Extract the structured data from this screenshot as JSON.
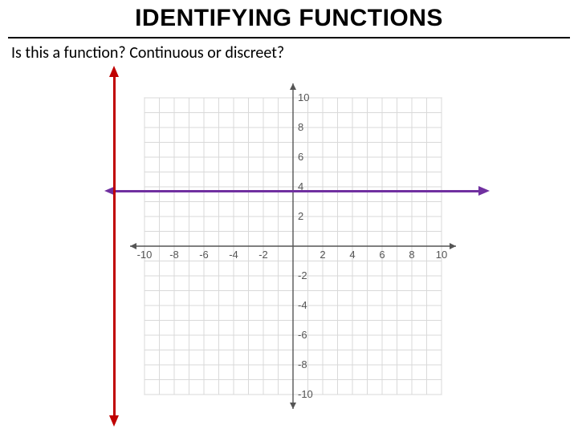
{
  "title": "IDENTIFYING FUNCTIONS",
  "subtitle": "Is this a function? Continuous or discreet?",
  "chart_data": {
    "type": "line",
    "title": "",
    "xlabel": "",
    "ylabel": "",
    "xlim": [
      -10,
      10
    ],
    "ylim": [
      -10,
      10
    ],
    "x_ticks": [
      -10,
      -8,
      -6,
      -4,
      -2,
      2,
      4,
      6,
      8,
      10
    ],
    "y_ticks": [
      -10,
      -8,
      -6,
      -4,
      -2,
      2,
      4,
      6,
      8,
      10
    ],
    "series": [
      {
        "name": "horizontal-line",
        "color": "#7030a0",
        "x": [
          -12,
          12
        ],
        "y": [
          3.5,
          3.5
        ],
        "arrows": "both"
      },
      {
        "name": "vertical-line-test",
        "color": "#c00000",
        "x": [
          -10.5,
          -10.5
        ],
        "y": [
          -11.5,
          11.5
        ],
        "arrows": "both"
      }
    ],
    "grid": true,
    "grid_step": 1
  },
  "colors": {
    "purple": "#7030a0",
    "red": "#c00000",
    "grid": "#d9d9d9",
    "axis": "#555555"
  }
}
